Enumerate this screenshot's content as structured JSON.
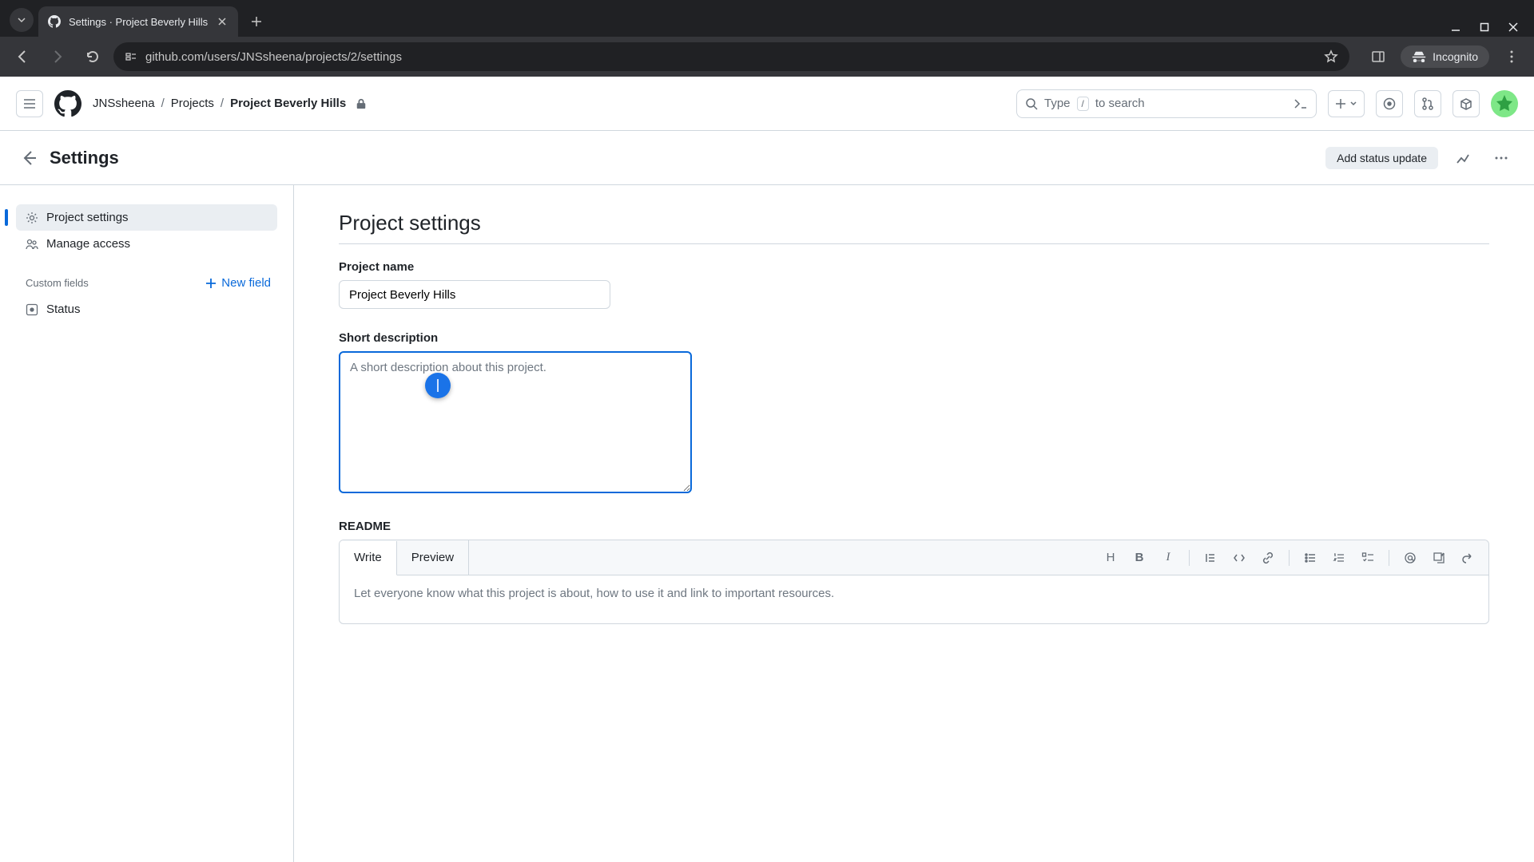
{
  "browser": {
    "tab_title": "Settings · Project Beverly Hills",
    "url": "github.com/users/JNSsheena/projects/2/settings",
    "incognito_label": "Incognito"
  },
  "gh_header": {
    "breadcrumb": {
      "user": "JNSsheena",
      "projects": "Projects",
      "current": "Project Beverly Hills"
    },
    "search_prefix": "Type",
    "search_key": "/",
    "search_suffix": "to search"
  },
  "page_header": {
    "title": "Settings",
    "add_status": "Add status update"
  },
  "sidebar": {
    "project_settings": "Project settings",
    "manage_access": "Manage access",
    "custom_fields_label": "Custom fields",
    "new_field": "New field",
    "status": "Status"
  },
  "main": {
    "heading": "Project settings",
    "project_name_label": "Project name",
    "project_name_value": "Project Beverly Hills",
    "short_desc_label": "Short description",
    "short_desc_placeholder": "A short description about this project.",
    "readme_label": "README",
    "readme_tabs": {
      "write": "Write",
      "preview": "Preview"
    },
    "readme_placeholder": "Let everyone know what this project is about, how to use it and link to important resources.",
    "toolbar": {
      "heading": "H",
      "bold": "B",
      "italic": "I"
    }
  }
}
